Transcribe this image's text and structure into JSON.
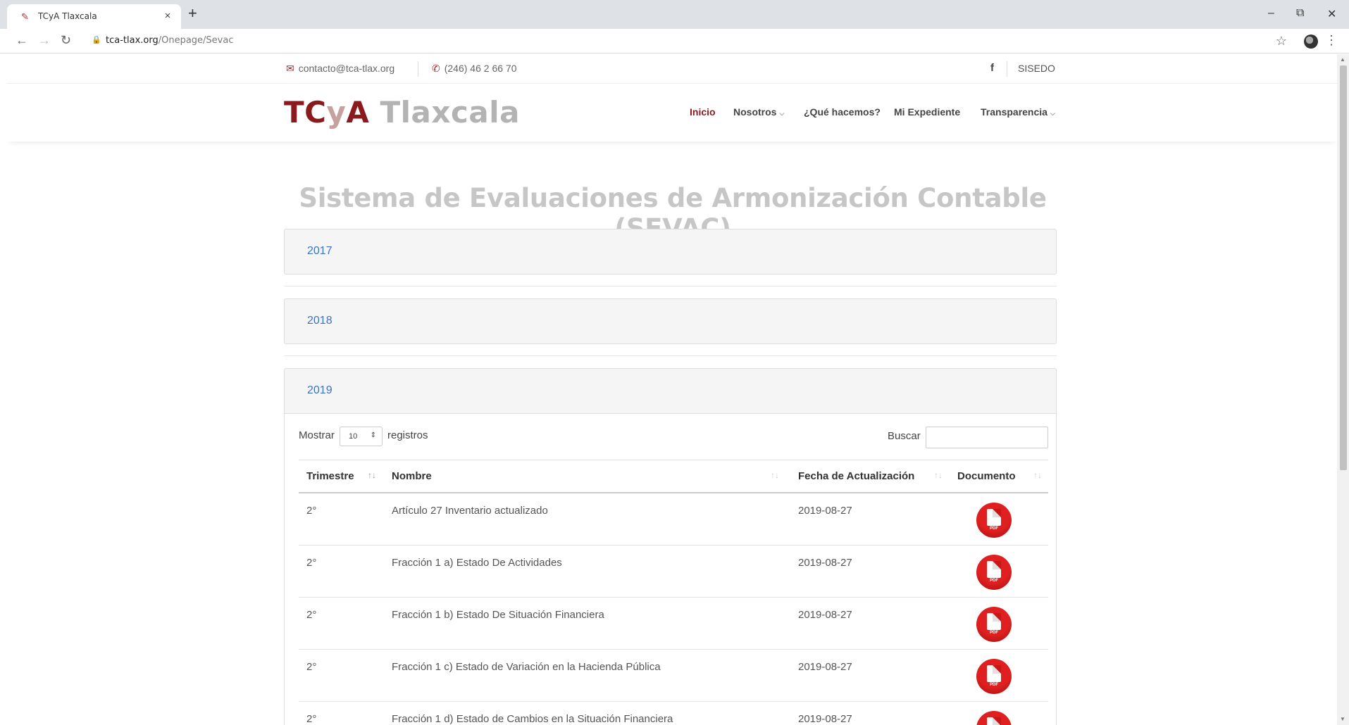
{
  "browser": {
    "tab_title": "TCyA Tlaxcala",
    "tab_close": "×",
    "new_tab": "+",
    "url_host": "tca-tlax.org",
    "url_path": "/Onepage/Sevac",
    "minimize": "–",
    "restore": "⧉",
    "close": "✕"
  },
  "topbar": {
    "email": "contacto@tca-tlax.org",
    "phone": "(246) 46 2 66 70",
    "facebook": "f",
    "sisedo": "SISEDO"
  },
  "header": {
    "logo_tc": "TC",
    "logo_y": "y",
    "logo_a": "A",
    "logo_tlaxcala": " Tlaxcala",
    "menu": [
      "Inicio",
      "Nosotros",
      "¿Qué hacemos?",
      "Mi Expediente",
      "Transparencia"
    ]
  },
  "page": {
    "title": "Sistema de Evaluaciones de Armonización Contable (SEVAC)",
    "panels": [
      "2017",
      "2018",
      "2019"
    ]
  },
  "table_controls": {
    "show_label": "Mostrar",
    "page_size": "10",
    "records_label": "registros",
    "search_label": "Buscar"
  },
  "table": {
    "headers": [
      "Trimestre",
      "Nombre",
      "Fecha de Actualización",
      "Documento"
    ],
    "rows": [
      {
        "trimestre": "2°",
        "nombre": "Artículo 27 Inventario actualizado",
        "fecha": "2019-08-27"
      },
      {
        "trimestre": "2°",
        "nombre": "Fracción 1 a) Estado De Actividades",
        "fecha": "2019-08-27"
      },
      {
        "trimestre": "2°",
        "nombre": "Fracción 1 b) Estado De Situación Financiera",
        "fecha": "2019-08-27"
      },
      {
        "trimestre": "2°",
        "nombre": "Fracción 1 c) Estado de Variación en la Hacienda Pública",
        "fecha": "2019-08-27"
      },
      {
        "trimestre": "2°",
        "nombre": "Fracción 1 d) Estado de Cambios en la Situación Financiera",
        "fecha": "2019-08-27"
      }
    ],
    "pdf_label": "PDF"
  },
  "colors": {
    "brand": "#8b1a1c",
    "link": "#3b73c6",
    "title_gray": "#c6c6c6"
  }
}
